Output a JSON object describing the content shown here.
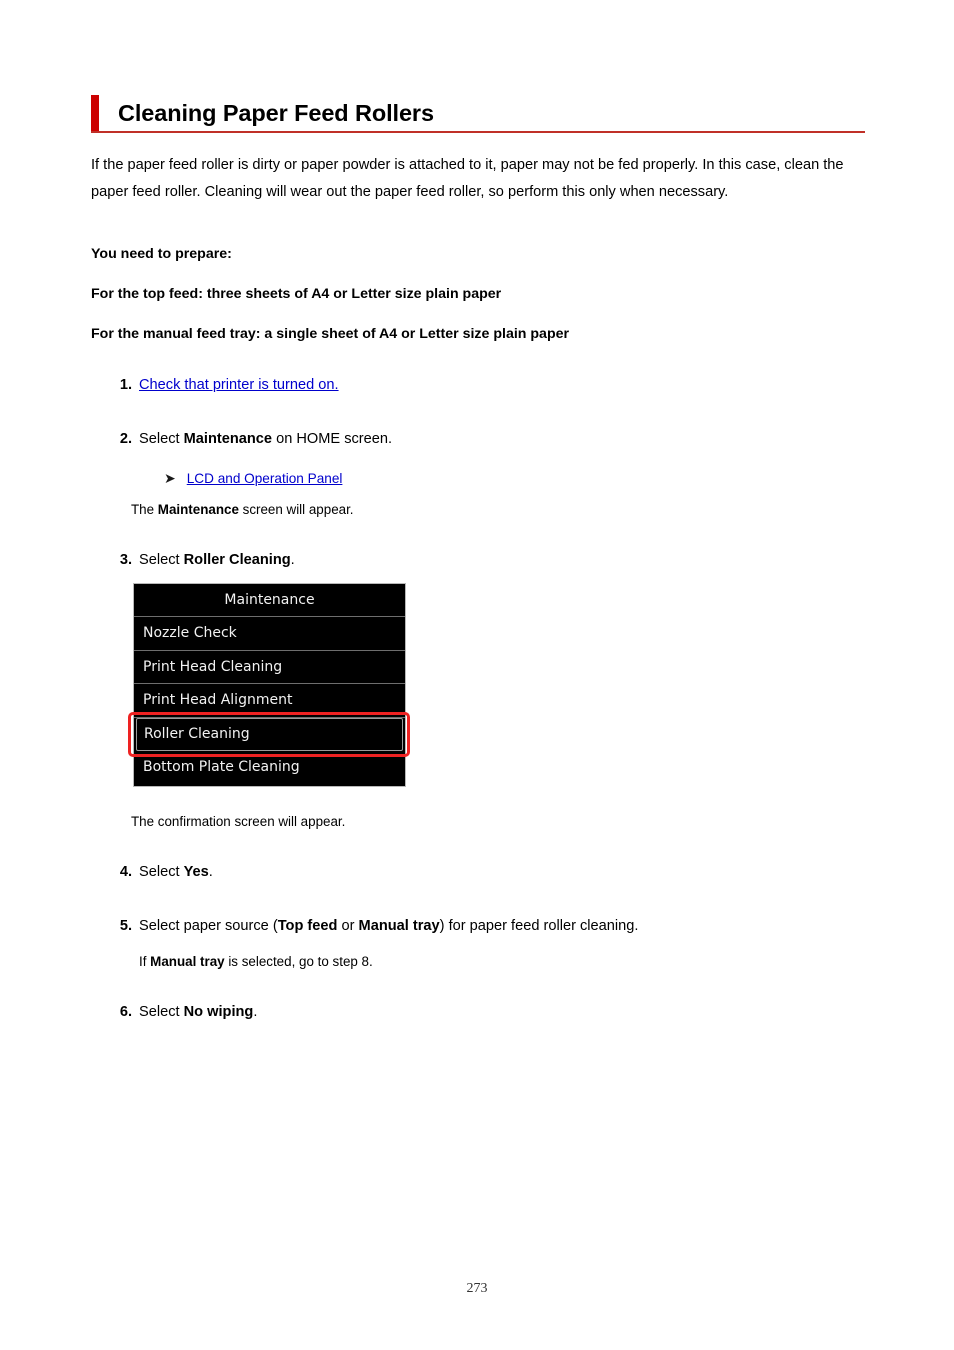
{
  "document": {
    "title": "Cleaning Paper Feed Rollers",
    "accent_color": "#cc0000",
    "rule_color": "#c03028",
    "link_color": "#0000cc",
    "page_number": "273"
  },
  "intro": {
    "paragraph": "If the paper feed roller is dirty or paper powder is attached to it, paper may not be fed properly. In this case, clean the paper feed roller. Cleaning will wear out the paper feed roller, so perform this only when necessary."
  },
  "prepare": {
    "heading": "You need to prepare:",
    "top_feed": "For the top feed: three sheets of A4 or Letter size plain paper",
    "manual_feed": "For the manual feed tray: a single sheet of A4 or Letter size plain paper"
  },
  "steps": {
    "one": {
      "number": "1.",
      "link_text": "Check that printer is turned on."
    },
    "two": {
      "number": "2.",
      "text_before": "Select ",
      "bold": "Maintenance",
      "text_after": " on HOME screen.",
      "arrow_icon": "right-arrow",
      "sub_link": "LCD and Operation Panel",
      "note_before": "The ",
      "note_bold": "Maintenance",
      "note_after": " screen will appear."
    },
    "three": {
      "number": "3.",
      "text_before": "Select ",
      "bold": "Roller Cleaning",
      "text_after": ".",
      "note": "The confirmation screen will appear."
    },
    "four": {
      "number": "4.",
      "text_before": "Select ",
      "bold": "Yes",
      "text_after": "."
    },
    "five": {
      "number": "5.",
      "text_1": "Select paper source (",
      "bold_1": "Top feed",
      "text_2": " or ",
      "bold_2": "Manual tray",
      "text_3": ") for paper feed roller cleaning.",
      "note_1": "If ",
      "note_bold": "Manual tray",
      "note_2": " is selected, go to step 8."
    },
    "six": {
      "number": "6.",
      "text_before": "Select ",
      "bold": "No wiping",
      "text_after": "."
    }
  },
  "lcd_screen": {
    "title": "Maintenance",
    "items": [
      {
        "label": "Nozzle Check",
        "selected": false
      },
      {
        "label": "Print Head Cleaning",
        "selected": false
      },
      {
        "label": "Print Head Alignment",
        "selected": false
      },
      {
        "label": "Roller Cleaning",
        "selected": true
      },
      {
        "label": "Bottom Plate Cleaning",
        "selected": false
      }
    ],
    "highlight_color": "#ee2222"
  }
}
